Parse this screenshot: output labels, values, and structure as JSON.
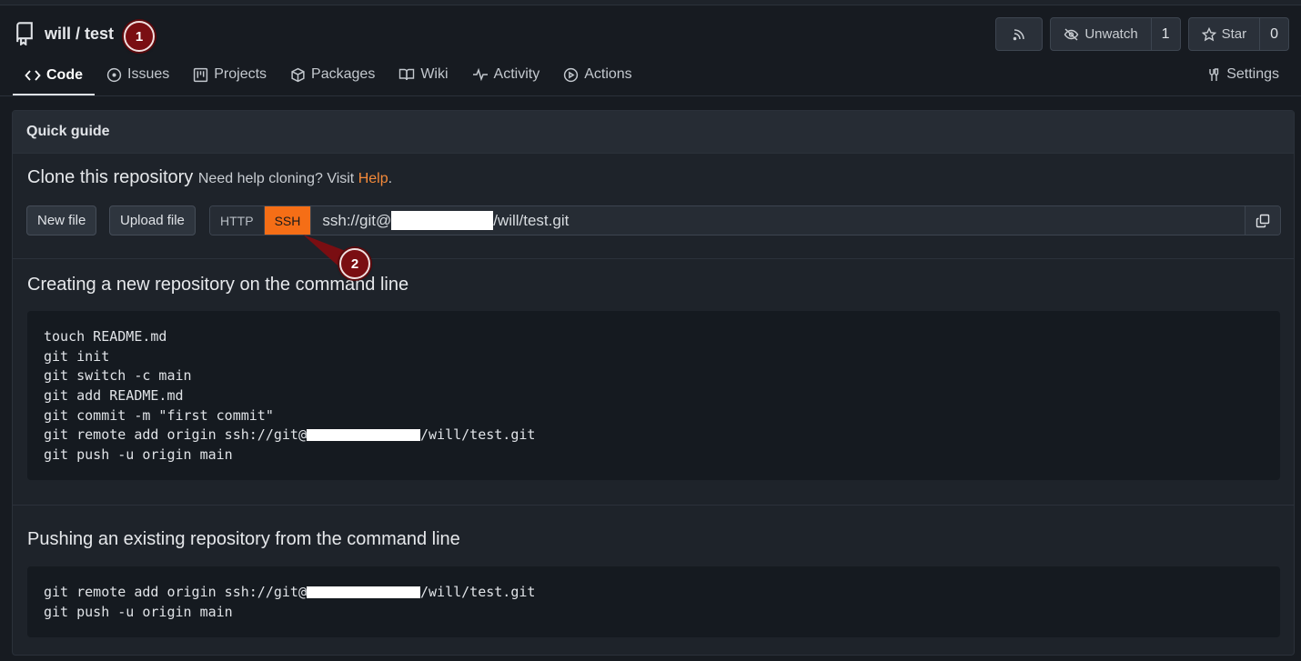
{
  "repo": {
    "owner_name": "will / test"
  },
  "annotations": {
    "badge1": "1",
    "badge2": "2"
  },
  "header_buttons": {
    "rss_icon": "rss-icon",
    "unwatch_label": "Unwatch",
    "unwatch_count": "1",
    "star_label": "Star",
    "star_count": "0"
  },
  "tabs": [
    {
      "label": "Code",
      "icon": "code-icon",
      "active": true
    },
    {
      "label": "Issues",
      "icon": "issue-icon"
    },
    {
      "label": "Projects",
      "icon": "project-icon"
    },
    {
      "label": "Packages",
      "icon": "package-icon"
    },
    {
      "label": "Wiki",
      "icon": "book-icon"
    },
    {
      "label": "Activity",
      "icon": "pulse-icon"
    },
    {
      "label": "Actions",
      "icon": "play-icon"
    },
    {
      "label": "Settings",
      "icon": "tools-icon"
    }
  ],
  "quick_guide": {
    "title": "Quick guide",
    "clone": {
      "title": "Clone this repository",
      "help_prefix": "Need help cloning? Visit",
      "help_link": "Help",
      "help_suffix": ".",
      "new_file": "New file",
      "upload_file": "Upload file",
      "proto_http": "HTTP",
      "proto_ssh": "SSH",
      "url_prefix": "ssh://git@",
      "url_suffix": "/will/test.git"
    },
    "new_repo": {
      "title": "Creating a new repository on the command line",
      "lines": [
        "touch README.md",
        "git init",
        "git switch -c main",
        "git add README.md",
        "git commit -m \"first commit\"",
        "git remote add origin ssh://git@",
        "/will/test.git",
        "git push -u origin main"
      ]
    },
    "existing_repo": {
      "title": "Pushing an existing repository from the command line",
      "remote_prefix": "git remote add origin ssh://git@",
      "remote_suffix": "/will/test.git",
      "push": "git push -u origin main"
    }
  },
  "colors": {
    "accent": "#f56e16",
    "badge": "#7a0e12",
    "link": "#f58a3a"
  }
}
